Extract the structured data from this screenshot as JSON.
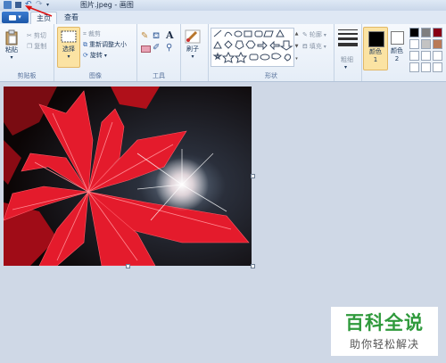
{
  "window": {
    "title": "图片.jpeg - 画图"
  },
  "tabs": {
    "home": "主页",
    "view": "查看"
  },
  "clipboard": {
    "paste": "粘贴",
    "cut": "剪切",
    "copy": "复制",
    "label": "剪贴板"
  },
  "image": {
    "select": "选择",
    "crop": "裁剪",
    "resize": "重新调整大小",
    "rotate": "旋转",
    "label": "图像"
  },
  "tools": {
    "label": "工具"
  },
  "brushes": {
    "label": "刷子"
  },
  "shapes": {
    "outline": "轮廓",
    "fill": "填充",
    "label": "形状"
  },
  "size": {
    "label": "粗细"
  },
  "colors": {
    "color1": "颜色 1",
    "color2": "颜色 2",
    "color1_value": "#000000",
    "color2_value": "#ffffff",
    "palette": [
      "#000000",
      "#7f7f7f",
      "#880015",
      "#ffffff",
      "#c3c3c3",
      "#b97a57",
      "#ffffff",
      "#ffffff",
      "#ffffff",
      "#ffffff",
      "#ffffff",
      "#ffffff"
    ]
  },
  "watermark": {
    "title": "百科全说",
    "subtitle": "助你轻松解决"
  }
}
